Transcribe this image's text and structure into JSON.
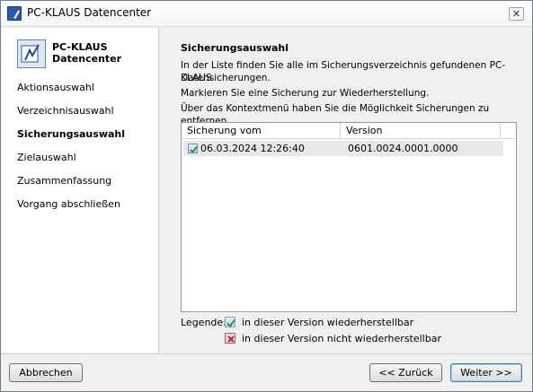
{
  "window": {
    "title": "PC-KLAUS Datencenter",
    "close_glyph": "✕"
  },
  "brand": {
    "line1": "PC-KLAUS",
    "line2": "Datencenter"
  },
  "nav": [
    {
      "label": "Aktionsauswahl"
    },
    {
      "label": "Verzeichnisauswahl"
    },
    {
      "label": "Sicherungsauswahl",
      "active": true
    },
    {
      "label": "Zielauswahl"
    },
    {
      "label": "Zusammenfassung"
    },
    {
      "label": "Vorgang abschließen"
    }
  ],
  "main": {
    "heading": "Sicherungsauswahl",
    "para1_line1": "In der Liste finden Sie alle im Sicherungsverzeichnis gefundenen PC-KLAUS",
    "para1_line2": "Datensicherungen.",
    "para2": "Markieren Sie eine Sicherung zur Wiederherstellung.",
    "para3": "Über das Kontextmenü haben Sie die Möglichkeit Sicherungen zu entfernen."
  },
  "table": {
    "columns": [
      "Sicherung vom",
      "Version"
    ],
    "rows": [
      {
        "date": "06.03.2024 12:26:40",
        "version": "0601.0024.0001.0000"
      }
    ]
  },
  "legend": {
    "label": "Legende:",
    "ok": "in dieser Version wiederherstellbar",
    "no": "in dieser Version nicht wiederherstellbar"
  },
  "buttons": {
    "cancel": "Abbrechen",
    "back": "<< Zurück",
    "next": "Weiter >>"
  },
  "colors": {
    "accent": "#3c7fb1",
    "selected_row": "#e8e8e8"
  }
}
